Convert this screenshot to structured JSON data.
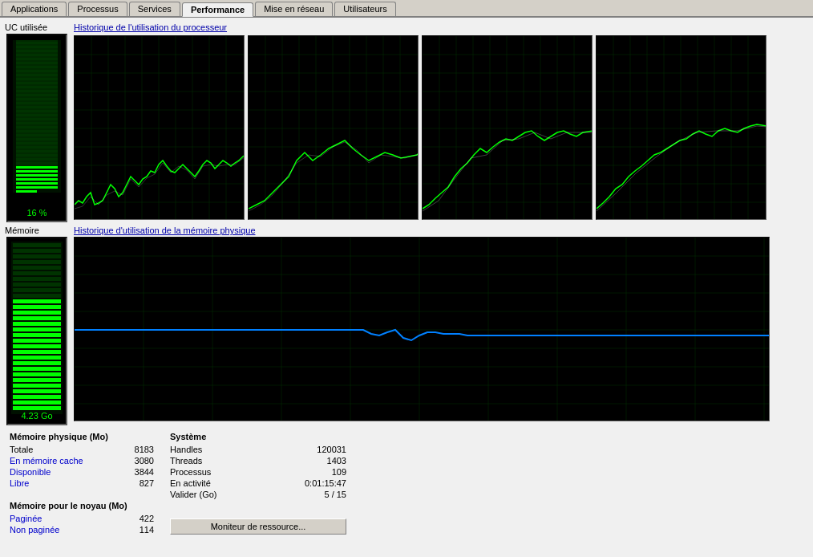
{
  "tabs": [
    {
      "label": "Applications",
      "active": false
    },
    {
      "label": "Processus",
      "active": false
    },
    {
      "label": "Services",
      "active": false
    },
    {
      "label": "Performance",
      "active": true
    },
    {
      "label": "Mise en réseau",
      "active": false
    },
    {
      "label": "Utilisateurs",
      "active": false
    }
  ],
  "cpu": {
    "section_label": "UC utilisée",
    "chart_title": "Historique de l'utilisation du processeur",
    "percent": "16 %"
  },
  "memory": {
    "section_label": "Mémoire",
    "chart_title": "Historique d'utilisation de la mémoire physique",
    "value": "4.23 Go"
  },
  "info": {
    "physical_title": "Mémoire physique (Mo)",
    "physical_rows": [
      {
        "label": "Totale",
        "value": "8183",
        "blue": false
      },
      {
        "label": "En mémoire cache",
        "value": "3080",
        "blue": true
      },
      {
        "label": "Disponible",
        "value": "3844",
        "blue": true
      },
      {
        "label": "Libre",
        "value": "827",
        "blue": true
      }
    ],
    "kernel_title": "Mémoire pour le noyau (Mo)",
    "kernel_rows": [
      {
        "label": "Paginée",
        "value": "422",
        "blue": true
      },
      {
        "label": "Non paginée",
        "value": "114",
        "blue": true
      }
    ],
    "system_title": "Système",
    "system_rows": [
      {
        "label": "Handles",
        "value": "120031"
      },
      {
        "label": "Threads",
        "value": "1403"
      },
      {
        "label": "Processus",
        "value": "109"
      },
      {
        "label": "En activité",
        "value": "0:01:15:47"
      },
      {
        "label": "Valider (Go)",
        "value": "5 / 15"
      }
    ],
    "monitor_button": "Moniteur de ressource..."
  }
}
